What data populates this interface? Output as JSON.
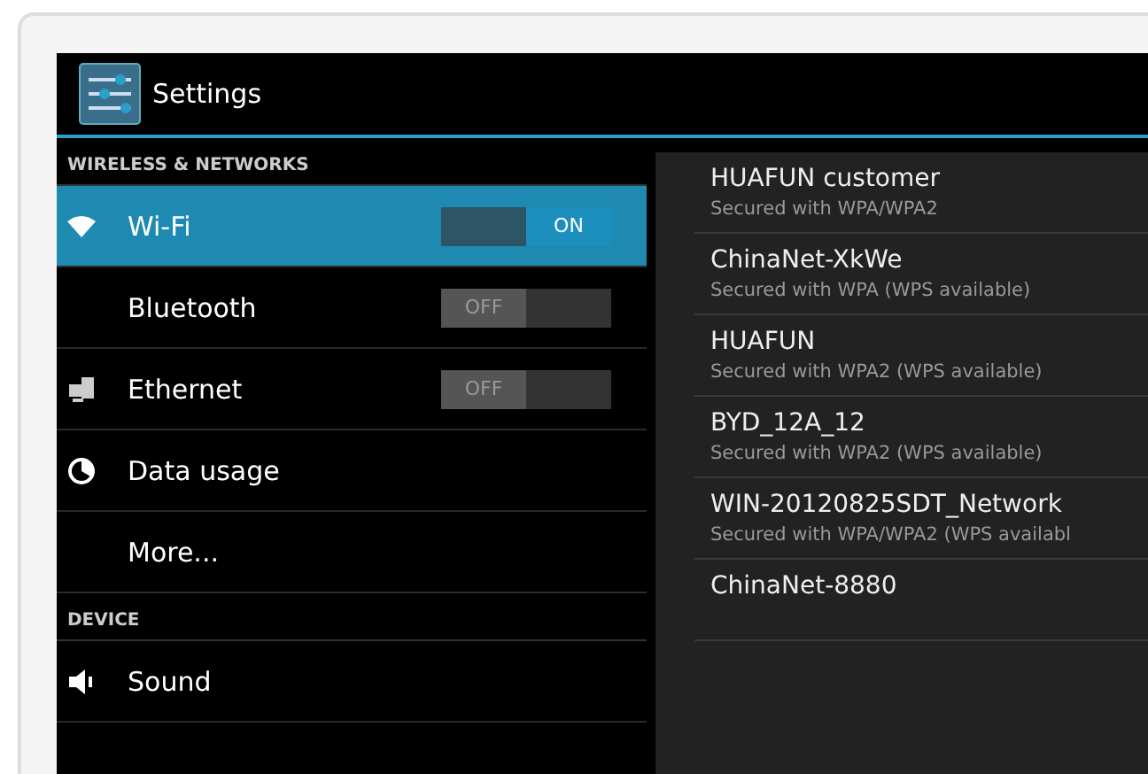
{
  "title_bar": {
    "title": "Settings"
  },
  "settings": [
    {
      "kind": "header",
      "label": "WIRELESS & NETWORKS"
    },
    {
      "kind": "item",
      "label": "Wi-Fi",
      "selected": true,
      "toggle": {
        "label": "ON",
        "on": true
      }
    },
    {
      "kind": "item",
      "label": "Bluetooth",
      "selected": false,
      "toggle": {
        "label": "OFF",
        "on": false
      }
    },
    {
      "kind": "item",
      "label": "Ethernet",
      "selected": false,
      "toggle": {
        "label": "OFF",
        "on": false
      }
    },
    {
      "kind": "item",
      "label": "Data usage",
      "selected": false
    },
    {
      "kind": "item",
      "label": "More...",
      "selected": false
    },
    {
      "kind": "header",
      "label": "DEVICE"
    },
    {
      "kind": "item",
      "label": "Sound",
      "selected": false
    }
  ],
  "networks": [
    {
      "name": "HUAFUN customer",
      "security": "Secured with WPA/WPA2"
    },
    {
      "name": "ChinaNet-XkWe",
      "security": "Secured with WPA (WPS available)"
    },
    {
      "name": "HUAFUN",
      "security": "Secured with WPA2 (WPS available)"
    },
    {
      "name": "BYD_12A_12",
      "security": "Secured with WPA2 (WPS available)"
    },
    {
      "name": "WIN-20120825SDT_Network",
      "security": "Secured with WPA/WPA2 (WPS availabl"
    },
    {
      "name": "ChinaNet-8880"
    }
  ]
}
